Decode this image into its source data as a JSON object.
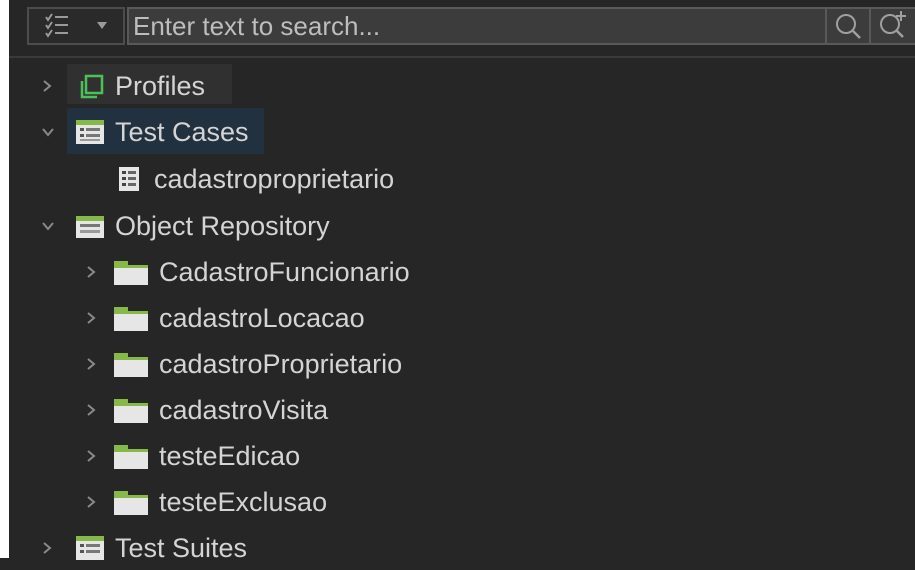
{
  "toolbar": {
    "search_placeholder": "Enter text to search...",
    "filter_icon": "checklist-filter-icon",
    "dropdown_icon": "dropdown-arrow-icon",
    "search_icon": "search-icon",
    "advanced_search_icon": "advanced-search-icon"
  },
  "tree": {
    "profiles": {
      "label": "Profiles",
      "state": "collapsed",
      "icon": "profiles-icon"
    },
    "test_cases": {
      "label": "Test Cases",
      "state": "expanded",
      "icon": "test-cases-folder-icon",
      "children": [
        {
          "label": "cadastroproprietario",
          "icon": "test-case-icon"
        }
      ]
    },
    "object_repository": {
      "label": "Object Repository",
      "state": "expanded",
      "icon": "object-repository-folder-icon",
      "children": [
        {
          "label": "CadastroFuncionario",
          "state": "collapsed",
          "icon": "folder-icon"
        },
        {
          "label": "cadastroLocacao",
          "state": "collapsed",
          "icon": "folder-icon"
        },
        {
          "label": "cadastroProprietario",
          "state": "collapsed",
          "icon": "folder-icon"
        },
        {
          "label": "cadastroVisita",
          "state": "collapsed",
          "icon": "folder-icon"
        },
        {
          "label": "testeEdicao",
          "state": "collapsed",
          "icon": "folder-icon"
        },
        {
          "label": "testeExclusao",
          "state": "collapsed",
          "icon": "folder-icon"
        }
      ]
    },
    "test_suites": {
      "label": "Test Suites",
      "state": "collapsed",
      "icon": "test-suites-folder-icon"
    }
  },
  "colors": {
    "background": "#262626",
    "text": "#d4d4d4",
    "selection": "#223140",
    "folder_green": "#86b84a",
    "icon_green": "#5fb85a"
  }
}
